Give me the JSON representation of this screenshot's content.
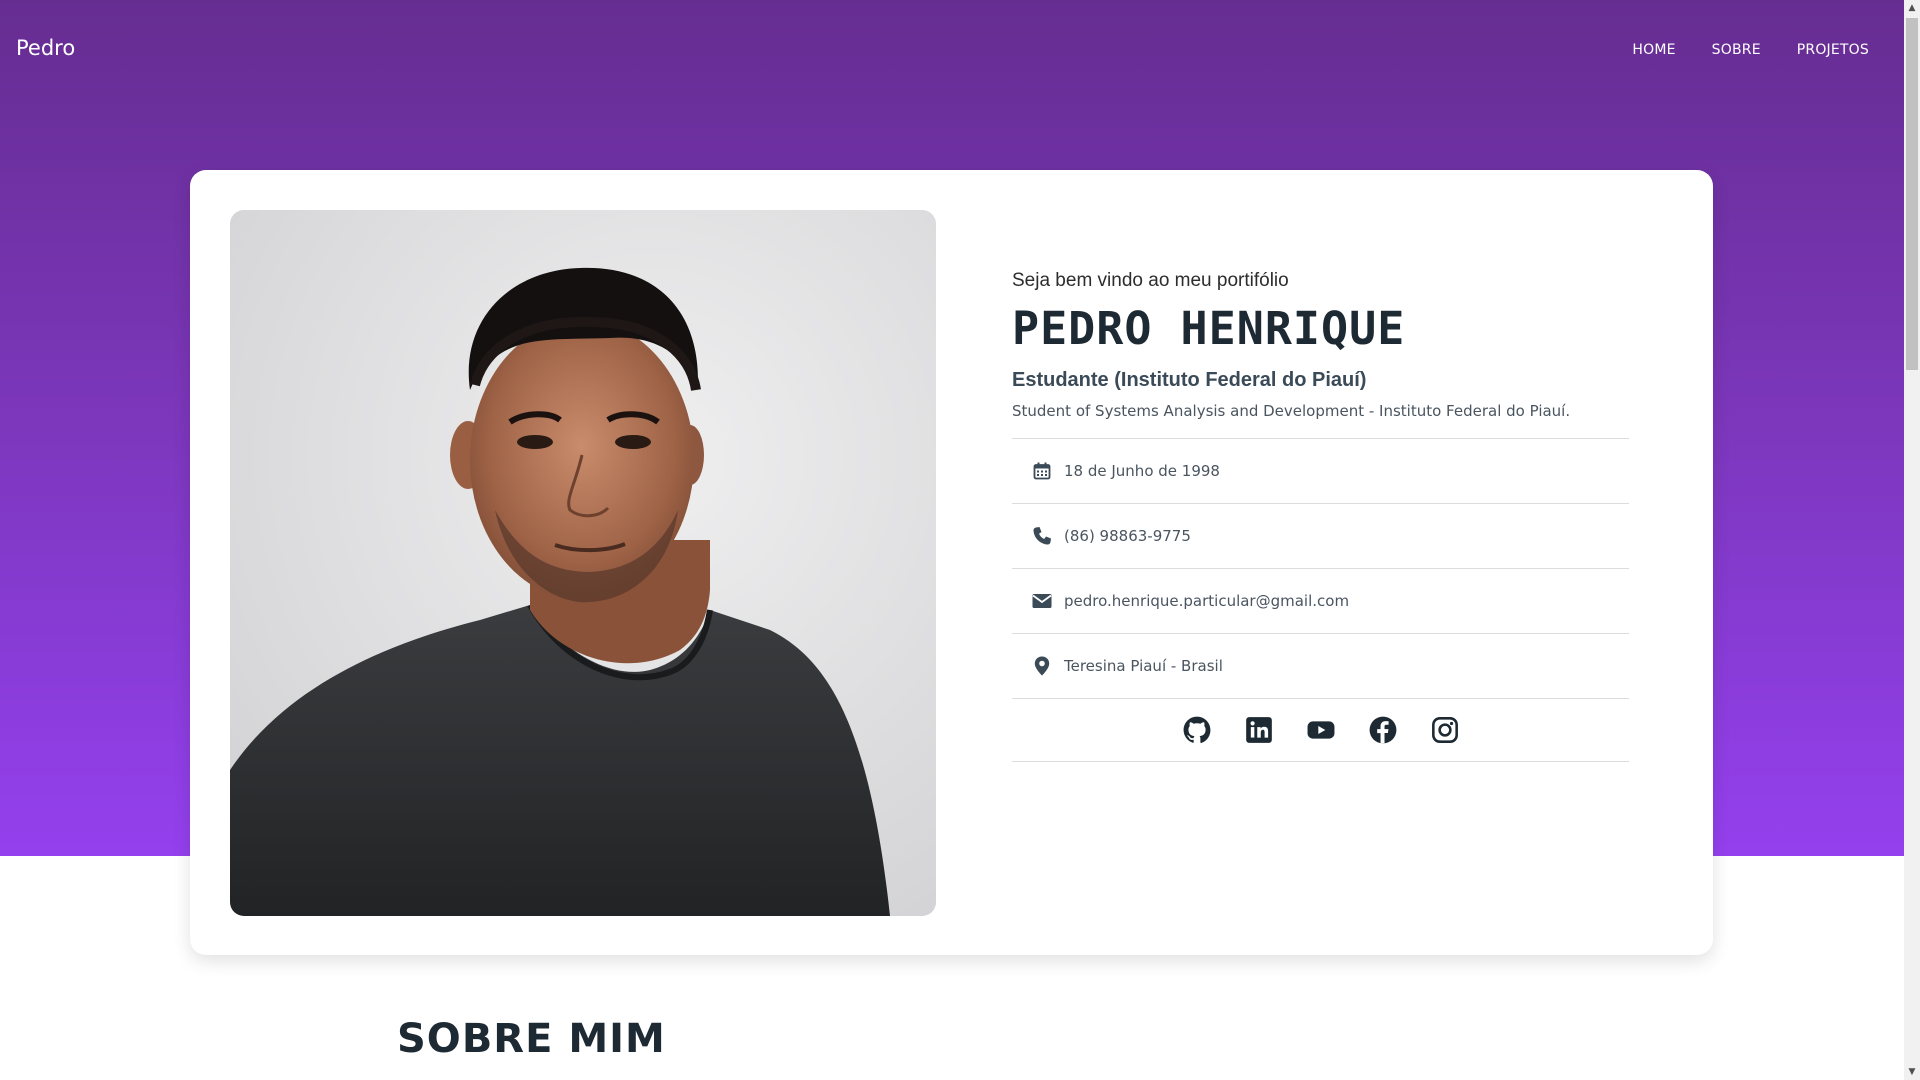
{
  "navbar": {
    "brand": "Pedro",
    "links": [
      {
        "label": "HOME"
      },
      {
        "label": "SOBRE"
      },
      {
        "label": "PROJETOS"
      }
    ]
  },
  "hero": {
    "welcome": "Seja bem vindo ao meu portifólio",
    "name": "PEDRO HENRIQUE",
    "role": "Estudante (Instituto Federal do Piauí)",
    "description": "Student of Systems Analysis and Development - Instituto Federal do Piauí.",
    "details": [
      {
        "icon": "calendar-icon",
        "text": "18 de Junho de 1998"
      },
      {
        "icon": "phone-icon",
        "text": "(86) 98863-9775"
      },
      {
        "icon": "envelope-icon",
        "text": "pedro.henrique.particular@gmail.com"
      },
      {
        "icon": "map-marker-icon",
        "text": "Teresina Piauí - Brasil"
      }
    ],
    "socials": [
      "github-icon",
      "linkedin-icon",
      "youtube-icon",
      "facebook-icon",
      "instagram-icon"
    ]
  },
  "about": {
    "title": "SOBRE MIM"
  },
  "colors": {
    "gradient_top": "#662d91",
    "gradient_bottom": "#9440ee",
    "text_dark": "#1e2a33",
    "icon_color": "#3a4a57"
  }
}
